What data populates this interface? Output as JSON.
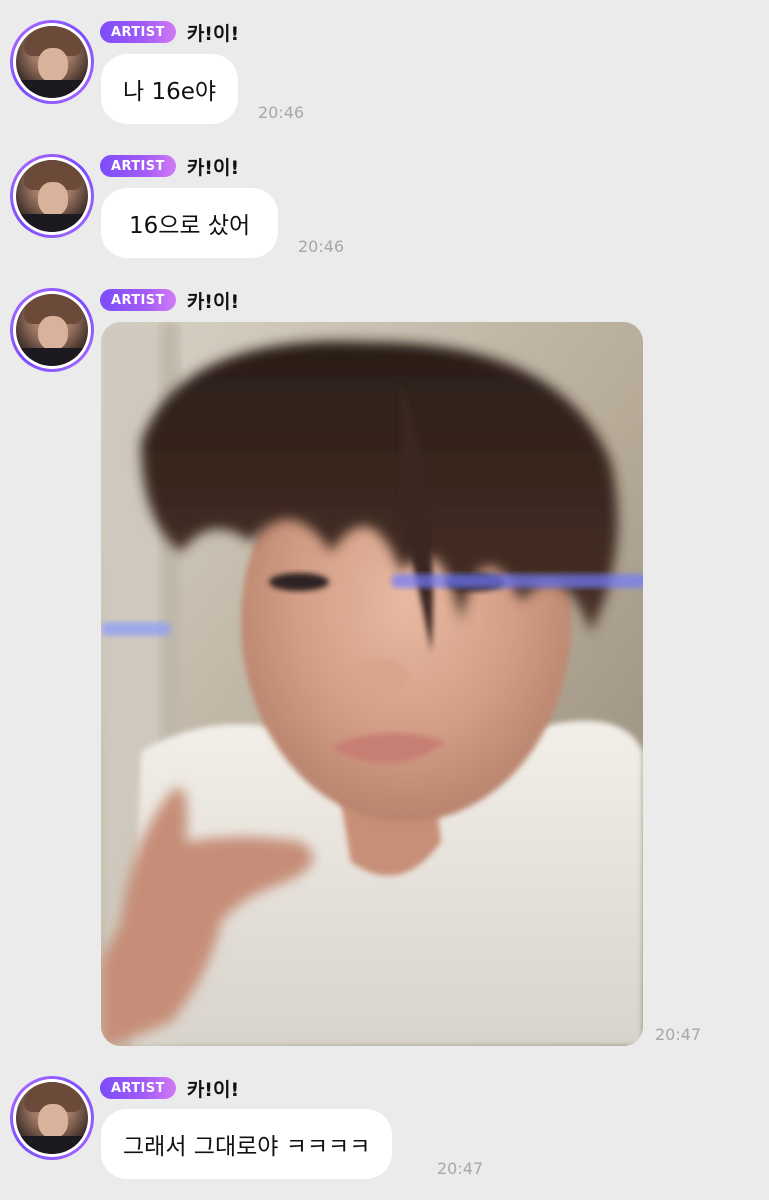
{
  "messages": [
    {
      "badge": "ARTIST",
      "sender": "카!이!",
      "text": "나 16e야",
      "time": "20:46"
    },
    {
      "badge": "ARTIST",
      "sender": "카!이!",
      "text": "16으로 샀어",
      "time": "20:46"
    },
    {
      "badge": "ARTIST",
      "sender": "카!이!",
      "image": "selfie-photo",
      "time": "20:47"
    },
    {
      "badge": "ARTIST",
      "sender": "카!이!",
      "text": "그래서 그대로야 ㅋㅋㅋㅋ",
      "time": "20:47"
    }
  ],
  "colors": {
    "background": "#ebebeb",
    "bubble": "#ffffff",
    "badge_gradient_start": "#7b4dfb",
    "badge_gradient_end": "#d17bf6",
    "avatar_ring": "#8f5cff",
    "timestamp": "#a7a7a7"
  }
}
